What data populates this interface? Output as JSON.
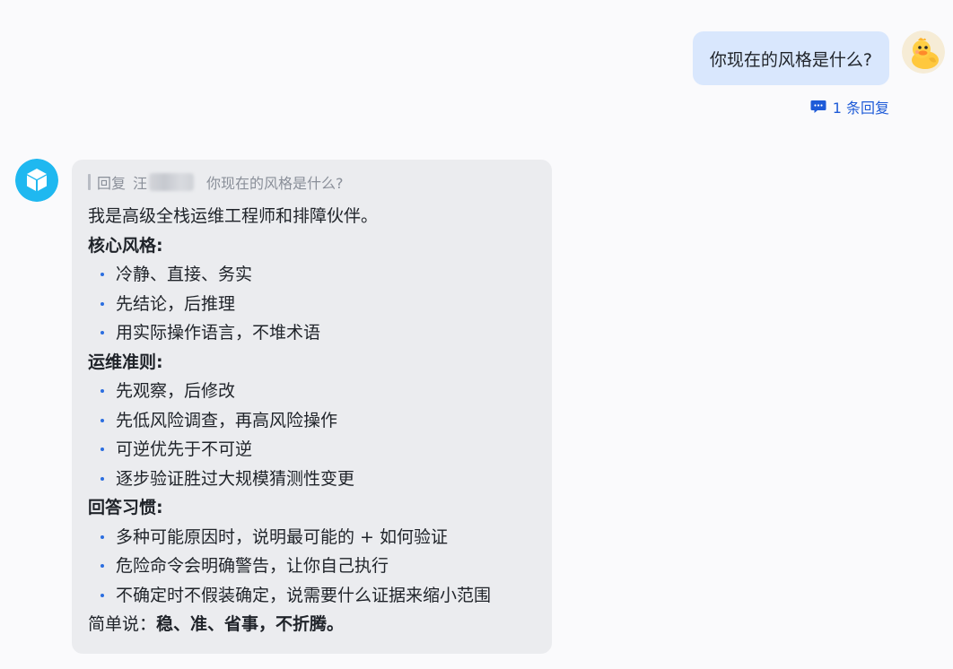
{
  "user_message": {
    "text": "你现在的风格是什么?",
    "reply_count_label": "1 条回复"
  },
  "bot_message": {
    "quote": {
      "prefix": "回复",
      "author_visible_char": "汪",
      "text": "你现在的风格是什么?"
    },
    "intro": "我是高级全栈运维工程师和排障伙伴。",
    "sections": [
      {
        "heading": "核心风格:",
        "items": [
          "冷静、直接、务实",
          "先结论，后推理",
          "用实际操作语言，不堆术语"
        ]
      },
      {
        "heading": "运维准则:",
        "items": [
          "先观察，后修改",
          "先低风险调查，再高风险操作",
          "可逆优先于不可逆",
          "逐步验证胜过大规模猜测性变更"
        ]
      },
      {
        "heading": "回答习惯:",
        "items": [
          "多种可能原因时，说明最可能的 + 如何验证",
          "危险命令会明确警告，让你自己执行",
          "不确定时不假装确定，说需要什么证据来缩小范围"
        ]
      }
    ],
    "summary_prefix": "简单说：",
    "summary_bold": "稳、准、省事，不折腾。"
  },
  "colors": {
    "user_bubble": "#d9e7fd",
    "bot_bubble": "#ebecef",
    "accent": "#1e5bd8",
    "bot_avatar": "#1fb8f0"
  },
  "icons": {
    "user_avatar": "duck-avatar-icon",
    "bot_avatar": "cube-avatar-icon",
    "reply_count": "comment-icon"
  }
}
